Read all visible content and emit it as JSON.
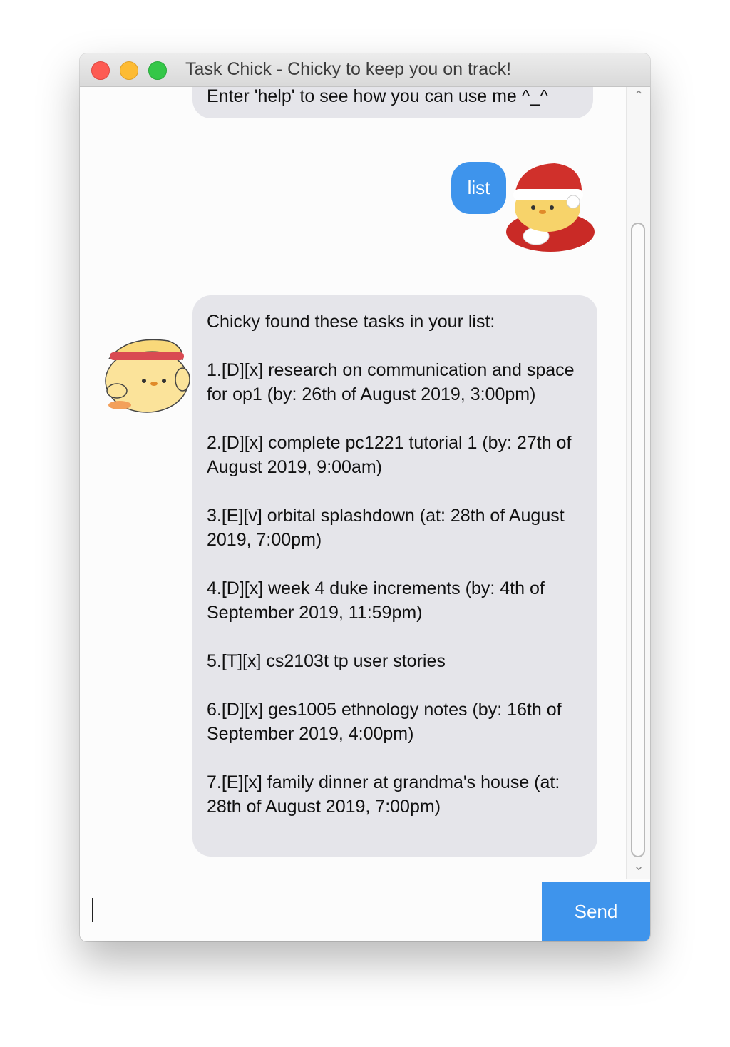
{
  "window": {
    "title": "Task Chick - Chicky to keep you on track!"
  },
  "chat": {
    "greeting_tail": "Enter 'help' to see how you can use me ^_^",
    "user_message": "list",
    "bot_intro": "Chicky found these tasks in your list:",
    "tasks": [
      "1.[D][x] research on communication and space for op1 (by: 26th of August 2019, 3:00pm)",
      "2.[D][x] complete pc1221 tutorial 1 (by: 27th of August 2019, 9:00am)",
      "3.[E][v] orbital splashdown (at: 28th of August 2019, 7:00pm)",
      "4.[D][x] week 4 duke increments (by: 4th of September 2019, 11:59pm)",
      "5.[T][x] cs2103t tp user stories",
      "6.[D][x] ges1005 ethnology notes (by: 16th of September 2019, 4:00pm)",
      "7.[E][x] family dinner at grandma's house (at: 28th of August 2019, 7:00pm)"
    ]
  },
  "input": {
    "value": "",
    "send_label": "Send"
  },
  "colors": {
    "user_bubble": "#3e94ec",
    "bot_bubble": "#e5e5ea",
    "send_button": "#3e94ec"
  },
  "icons": {
    "user_avatar": "santa-chick-icon",
    "bot_avatar": "headband-chick-icon"
  }
}
